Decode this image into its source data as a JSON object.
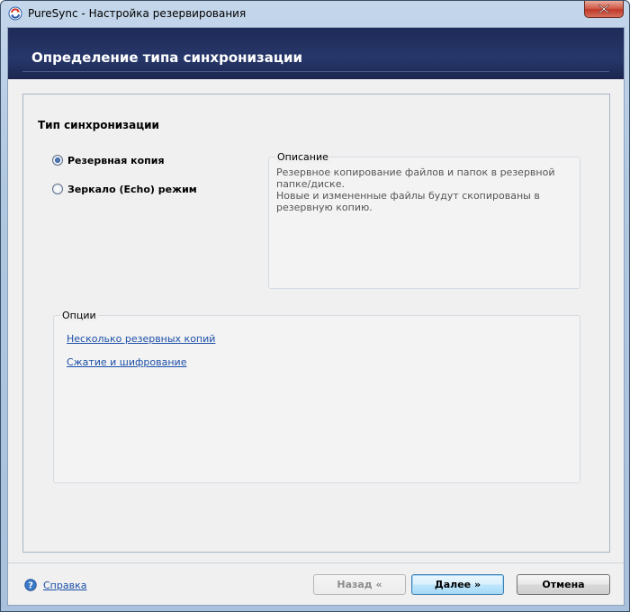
{
  "window": {
    "title": "PureSync - Настройка резервирования"
  },
  "header": {
    "title": "Определение типа синхронизации"
  },
  "sync_type": {
    "section_title": "Тип синхронизации",
    "options": [
      {
        "label": "Резервная копия",
        "checked": true
      },
      {
        "label": "Зеркало (Echo) режим",
        "checked": false
      }
    ]
  },
  "description": {
    "legend": "Описание",
    "text": "Резервное копирование файлов и папок в резервной папке/диске.\nНовые и измененные файлы будут скопированы в резервную копию."
  },
  "options_group": {
    "legend": "Опции",
    "links": [
      {
        "label": "Несколько резервных копий"
      },
      {
        "label": "Сжатие и шифрование"
      }
    ]
  },
  "footer": {
    "help_label": "Справка",
    "back_label": "Назад «",
    "next_label": "Далее »",
    "cancel_label": "Отмена"
  },
  "icons": {
    "app": "sync-arrows-icon",
    "close": "close-icon",
    "help": "help-icon"
  }
}
